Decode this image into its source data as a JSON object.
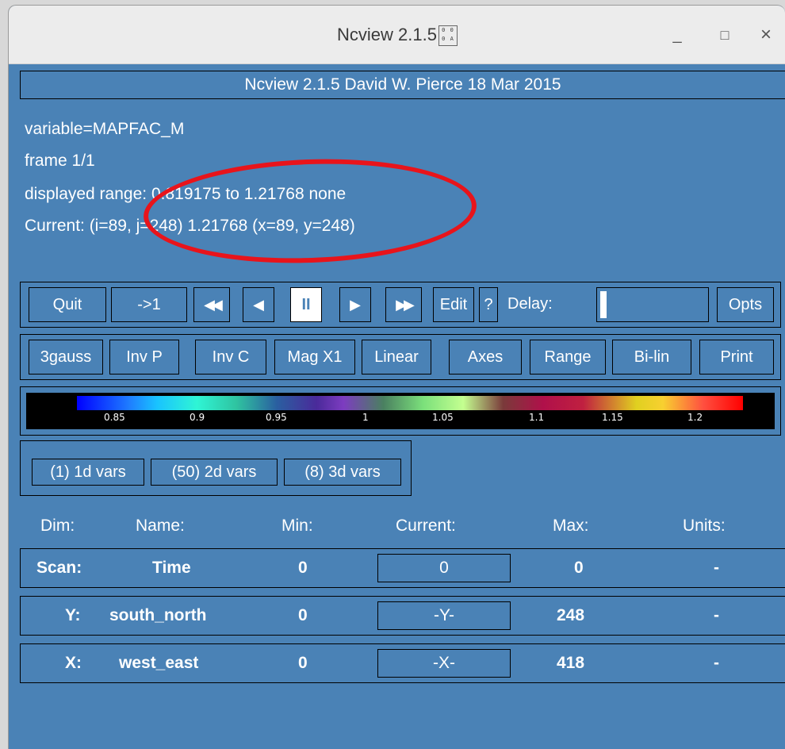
{
  "window": {
    "title": "Ncview 2.1.5",
    "title_glyph": "0 0 0 A",
    "minimize": "_",
    "maximize": "□",
    "close": "×"
  },
  "header": "Ncview 2.1.5 David W. Pierce  18 Mar 2015",
  "info": {
    "variable": "variable=MAPFAC_M",
    "frame": "frame 1/1",
    "range": "displayed range: 0.819175 to 1.21768 none",
    "current": "Current: (i=89, j=248) 1.21768 (x=89, y=248)"
  },
  "controls": {
    "quit": "Quit",
    "to1": "->1",
    "rewind": "◀◀",
    "back": "◀",
    "pause": "II",
    "forward": "▶",
    "fastforward": "▶▶",
    "edit": "Edit",
    "help": "?",
    "delay_label": "Delay:",
    "opts": "Opts"
  },
  "options": {
    "gauss": "3gauss",
    "invp": "Inv P",
    "invc": "Inv C",
    "mag": "Mag X1",
    "linear": "Linear",
    "axes": "Axes",
    "range": "Range",
    "bilin": "Bi-lin",
    "print": "Print"
  },
  "colorbar_ticks": [
    "0.85",
    "0.9",
    "0.95",
    "1",
    "1.05",
    "1.1",
    "1.15",
    "1.2"
  ],
  "vars": {
    "v1d": "(1) 1d vars",
    "v2d": "(50) 2d vars",
    "v3d": "(8) 3d vars"
  },
  "table": {
    "headers": {
      "dim": "Dim:",
      "name": "Name:",
      "min": "Min:",
      "current": "Current:",
      "max": "Max:",
      "units": "Units:"
    },
    "rows": [
      {
        "dim": "Scan:",
        "name": "Time",
        "min": "0",
        "current": "0",
        "max": "0",
        "units": "-"
      },
      {
        "dim": "Y:",
        "name": "south_north",
        "min": "0",
        "current": "-Y-",
        "max": "248",
        "units": "-"
      },
      {
        "dim": "X:",
        "name": "west_east",
        "min": "0",
        "current": "-X-",
        "max": "418",
        "units": "-"
      }
    ]
  }
}
